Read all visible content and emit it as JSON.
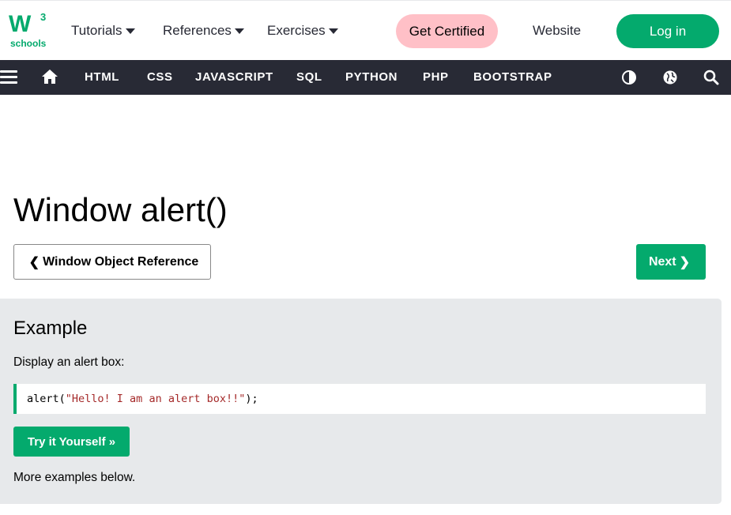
{
  "logo": {
    "letter": "W",
    "superscript": "3",
    "subtext": "schools"
  },
  "top_menu": {
    "tutorials": "Tutorials",
    "references": "References",
    "exercises": "Exercises",
    "get_certified": "Get Certified",
    "website": "Website",
    "login": "Log in"
  },
  "nav": {
    "links": [
      "HTML",
      "CSS",
      "JAVASCRIPT",
      "SQL",
      "PYTHON",
      "PHP",
      "BOOTSTRAP"
    ],
    "icons": [
      "menu-icon",
      "home-icon",
      "contrast-icon",
      "globe-icon",
      "search-icon"
    ]
  },
  "page": {
    "title": "Window alert()",
    "prev_button": "Window Object Reference",
    "next_button": "Next"
  },
  "example": {
    "heading": "Example",
    "description": "Display an alert box:",
    "code_fn": "alert(",
    "code_string": "\"Hello! I am an alert box!!\"",
    "code_end": ");",
    "try_button": "Try it Yourself »",
    "more_text": "More examples below."
  },
  "colors": {
    "brand_green": "#04AA6D",
    "nav_dark": "#282A35",
    "cert_pink": "#ffc0c7",
    "example_bg": "#e7e9eb",
    "code_string": "#a52a2a"
  }
}
